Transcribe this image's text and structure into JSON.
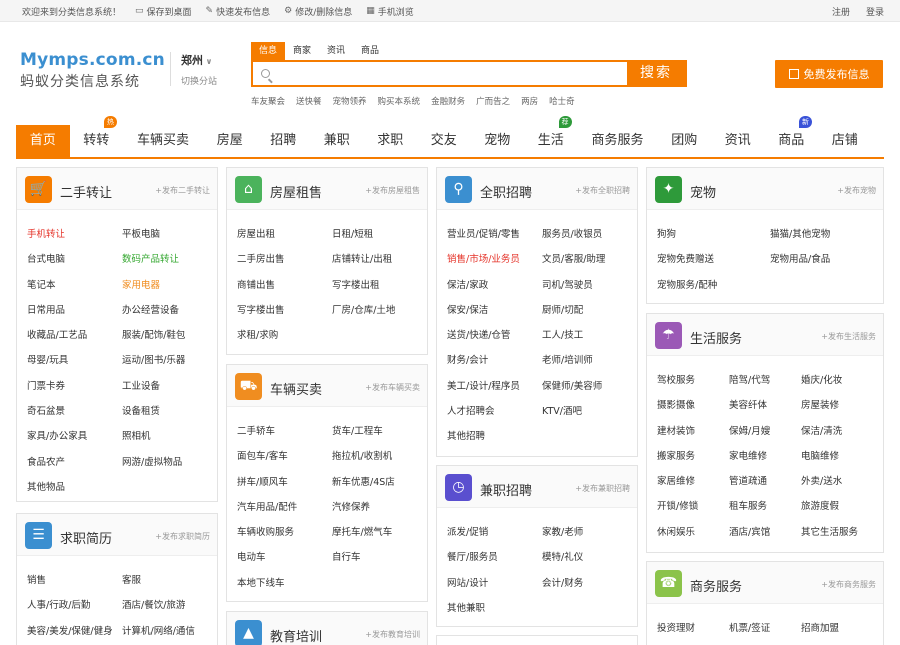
{
  "topbar": {
    "welcome": "欢迎来到分类信息系统！",
    "save_desktop": "保存到桌面",
    "quick_post": "快速发布信息",
    "edit_delete": "修改/删除信息",
    "mobile": "手机浏览",
    "register": "注册",
    "login": "登录"
  },
  "logo": {
    "en": "Mymps.com.cn",
    "cn": "蚂蚁分类信息系统"
  },
  "city": {
    "name": "郑州",
    "switch": "切换分站"
  },
  "search": {
    "tabs": [
      "信息",
      "商家",
      "资讯",
      "商品"
    ],
    "button": "搜索",
    "hot": [
      "车友聚会",
      "送快餐",
      "宠物领养",
      "购买本系统",
      "金融财务",
      "广而告之",
      "两房",
      "哈士奇"
    ]
  },
  "publish": "免费发布信息",
  "nav": [
    {
      "label": "首页",
      "active": true
    },
    {
      "label": "转转",
      "badge": "热",
      "badge_color": "#f57c00"
    },
    {
      "label": "车辆买卖"
    },
    {
      "label": "房屋"
    },
    {
      "label": "招聘"
    },
    {
      "label": "兼职"
    },
    {
      "label": "求职"
    },
    {
      "label": "交友"
    },
    {
      "label": "宠物"
    },
    {
      "label": "生活",
      "badge": "荐",
      "badge_color": "#2e9a3a"
    },
    {
      "label": "商务服务"
    },
    {
      "label": "团购"
    },
    {
      "label": "资讯"
    },
    {
      "label": "商品",
      "badge": "新",
      "badge_color": "#3a53d8"
    },
    {
      "label": "店铺"
    }
  ],
  "panels": {
    "secondhand": {
      "title": "二手转让",
      "link": "+发布二手转让",
      "icon_color": "#f57c00",
      "items": [
        {
          "t": "手机转让",
          "c": "red"
        },
        {
          "t": "平板电脑"
        },
        {
          "t": "台式电脑"
        },
        {
          "t": "数码产品转让",
          "c": "green"
        },
        {
          "t": "笔记本"
        },
        {
          "t": "家用电器",
          "c": "orange"
        },
        {
          "t": "日常用品"
        },
        {
          "t": "办公经营设备"
        },
        {
          "t": "收藏品/工艺品"
        },
        {
          "t": "服装/配饰/鞋包"
        },
        {
          "t": "母婴/玩具"
        },
        {
          "t": "运动/图书/乐器"
        },
        {
          "t": "门票卡券"
        },
        {
          "t": "工业设备"
        },
        {
          "t": "奇石盆景"
        },
        {
          "t": "设备租赁"
        },
        {
          "t": "家具/办公家具"
        },
        {
          "t": "照相机"
        },
        {
          "t": "食品农产"
        },
        {
          "t": "网游/虚拟物品"
        },
        {
          "t": "其他物品"
        }
      ]
    },
    "resume": {
      "title": "求职简历",
      "link": "+发布求职简历",
      "icon_color": "#3b8fd0",
      "items": [
        {
          "t": "销售"
        },
        {
          "t": "客服"
        },
        {
          "t": "人事/行政/后勤"
        },
        {
          "t": "酒店/餐饮/旅游"
        },
        {
          "t": "美容/美发/保健/健身"
        },
        {
          "t": "计算机/网络/通信"
        }
      ]
    },
    "house": {
      "title": "房屋租售",
      "link": "+发布房屋租售",
      "icon_color": "#4bb35c",
      "items": [
        {
          "t": "房屋出租"
        },
        {
          "t": "日租/短租"
        },
        {
          "t": "二手房出售"
        },
        {
          "t": "店铺转让/出租"
        },
        {
          "t": "商铺出售"
        },
        {
          "t": "写字楼出租"
        },
        {
          "t": "写字楼出售"
        },
        {
          "t": "厂房/仓库/土地"
        },
        {
          "t": "求租/求购"
        }
      ]
    },
    "car": {
      "title": "车辆买卖",
      "link": "+发布车辆买卖",
      "icon_color": "#f08d20",
      "items": [
        {
          "t": "二手轿车"
        },
        {
          "t": "货车/工程车"
        },
        {
          "t": "面包车/客车"
        },
        {
          "t": "拖拉机/收割机"
        },
        {
          "t": "拼车/顺风车"
        },
        {
          "t": "新车优惠/4S店"
        },
        {
          "t": "汽车用品/配件"
        },
        {
          "t": "汽修保养"
        },
        {
          "t": "车辆收购服务"
        },
        {
          "t": "摩托车/燃气车"
        },
        {
          "t": "电动车"
        },
        {
          "t": "自行车"
        },
        {
          "t": "本地下线车"
        }
      ]
    },
    "edu": {
      "title": "教育培训",
      "link": "+发布教育培训",
      "icon_color": "#3b8fd0"
    },
    "jobs": {
      "title": "全职招聘",
      "link": "+发布全职招聘",
      "icon_color": "#3b8fd0",
      "items": [
        {
          "t": "营业员/促销/零售"
        },
        {
          "t": "服务员/收银员"
        },
        {
          "t": "销售/市场/业务员",
          "c": "red"
        },
        {
          "t": "文员/客服/助理"
        },
        {
          "t": "保洁/家政"
        },
        {
          "t": "司机/驾驶员"
        },
        {
          "t": "保安/保洁"
        },
        {
          "t": "厨师/切配"
        },
        {
          "t": "送货/快递/仓管"
        },
        {
          "t": "工人/技工"
        },
        {
          "t": "财务/会计"
        },
        {
          "t": "老师/培训师"
        },
        {
          "t": "美工/设计/程序员"
        },
        {
          "t": "保健师/美容师"
        },
        {
          "t": "人才招聘会"
        },
        {
          "t": "KTV/酒吧"
        },
        {
          "t": "其他招聘"
        }
      ]
    },
    "parttime": {
      "title": "兼职招聘",
      "link": "+发布兼职招聘",
      "icon_color": "#5a4fcf",
      "items": [
        {
          "t": "派发/促销"
        },
        {
          "t": "家教/老师"
        },
        {
          "t": "餐厅/服务员"
        },
        {
          "t": "模特/礼仪"
        },
        {
          "t": "网站/设计"
        },
        {
          "t": "会计/财务"
        },
        {
          "t": "其他兼职"
        }
      ]
    },
    "pet": {
      "title": "宠物",
      "link": "+发布宠物",
      "icon_color": "#2e9a3a",
      "items": [
        {
          "t": "狗狗"
        },
        {
          "t": "猫猫/其他宠物"
        },
        {
          "t": "宠物免费赠送"
        },
        {
          "t": "宠物用品/食品"
        },
        {
          "t": "宠物服务/配种"
        }
      ]
    },
    "life": {
      "title": "生活服务",
      "link": "+发布生活服务",
      "icon_color": "#9b59b6",
      "items": [
        {
          "t": "驾校服务"
        },
        {
          "t": "陪驾/代驾"
        },
        {
          "t": "婚庆/化妆"
        },
        {
          "t": "摄影摄像"
        },
        {
          "t": "美容纤体"
        },
        {
          "t": "房屋装修"
        },
        {
          "t": "建材装饰"
        },
        {
          "t": "保姆/月嫂"
        },
        {
          "t": "保洁/清洗"
        },
        {
          "t": "搬家服务"
        },
        {
          "t": "家电维修"
        },
        {
          "t": "电脑维修"
        },
        {
          "t": "家居维修"
        },
        {
          "t": "管道疏通"
        },
        {
          "t": "外卖/送水"
        },
        {
          "t": "开锁/修锁"
        },
        {
          "t": "租车服务"
        },
        {
          "t": "旅游度假"
        },
        {
          "t": "休闲娱乐"
        },
        {
          "t": "酒店/宾馆"
        },
        {
          "t": "其它生活服务"
        }
      ]
    },
    "business": {
      "title": "商务服务",
      "link": "+发布商务服务",
      "icon_color": "#8bc34a",
      "items": [
        {
          "t": "投资理财"
        },
        {
          "t": "机票/签证"
        },
        {
          "t": "招商加盟"
        }
      ]
    }
  }
}
